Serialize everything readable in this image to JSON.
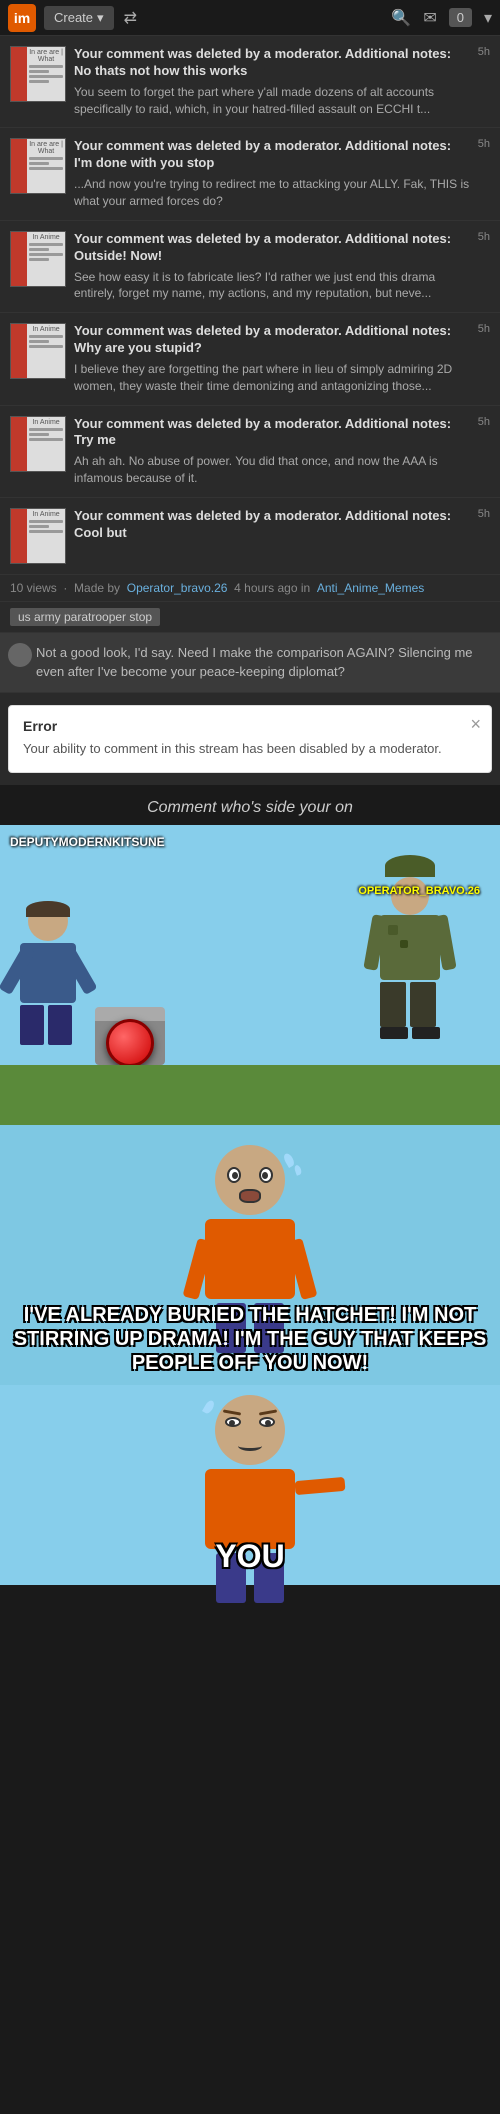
{
  "nav": {
    "logo": "im",
    "create_label": "Create",
    "dropdown_arrow": "▾",
    "shuffle_icon": "⇄",
    "search_icon": "🔍",
    "mail_icon": "✉",
    "notif_count": "0",
    "dropdown2": "▾"
  },
  "notifications": [
    {
      "id": 1,
      "title": "Your comment was deleted by a moderator. Additional notes: No thats not how this works",
      "body": "You seem to forget the part where y'all made dozens of alt accounts specifically to raid, which, in your hatred-filled assault on ECCHI t...",
      "time": "5h",
      "thumb_label": "In are are | What"
    },
    {
      "id": 2,
      "title": "Your comment was deleted by a moderator. Additional notes: I'm done with you stop",
      "body": "...And now you're trying to redirect me to attacking your ALLY. Fak, THIS is what your armed forces do?",
      "time": "5h",
      "thumb_label": "In are are | What"
    },
    {
      "id": 3,
      "title": "Your comment was deleted by a moderator. Additional notes: Outside! Now!",
      "body": "See how easy it is to fabricate lies? I'd rather we just end this drama entirely, forget my name, my actions, and my reputation, but neve...",
      "time": "5h",
      "thumb_label": "In Anime"
    },
    {
      "id": 4,
      "title": "Your comment was deleted by a moderator. Additional notes: Why are you stupid?",
      "body": "I believe they are forgetting the part where in lieu of simply admiring 2D women, they waste their time demonizing and antagonizing those...",
      "time": "5h",
      "thumb_label": "In Anime"
    },
    {
      "id": 5,
      "title": "Your comment was deleted by a moderator. Additional notes: Try me",
      "body": "Ah ah ah. No abuse of power. You did that once, and now the AAA is infamous because of it.",
      "time": "5h",
      "thumb_label": "In Anime"
    },
    {
      "id": 6,
      "title": "Your comment was deleted by a moderator. Additional notes: Cool but",
      "body": "",
      "time": "5h",
      "thumb_label": "In Anime"
    }
  ],
  "views_row": {
    "views": "10 views",
    "made_by": "Made by",
    "author": "Operator_bravo.26",
    "time_ago": "4 hours ago in",
    "community": "Anti_Anime_Memes"
  },
  "tag": {
    "label": "us army paratrooper stop"
  },
  "comment_preview": {
    "text": "Not a good look, I'd say. Need I make the comparison AGAIN? Silencing me even after I've become your peace-keeping diplomat?"
  },
  "error": {
    "title": "Error",
    "message": "Your ability to comment in this stream has been disabled by a moderator.",
    "close": "×"
  },
  "meme1": {
    "title": "Comment who's side your on",
    "label_deputy": "DEPUTYMODERNKITSUNE",
    "label_operator": "OPERATOR_BRAVO.26"
  },
  "meme2": {
    "big_text": "I'VE ALREADY BURIED THE HATCHET! I'M NOT STIRRING UP DRAMA! I'M THE GUY THAT KEEPS PEOPLE OFF YOU NOW!"
  },
  "meme3": {
    "bottom_text": "YOU"
  }
}
